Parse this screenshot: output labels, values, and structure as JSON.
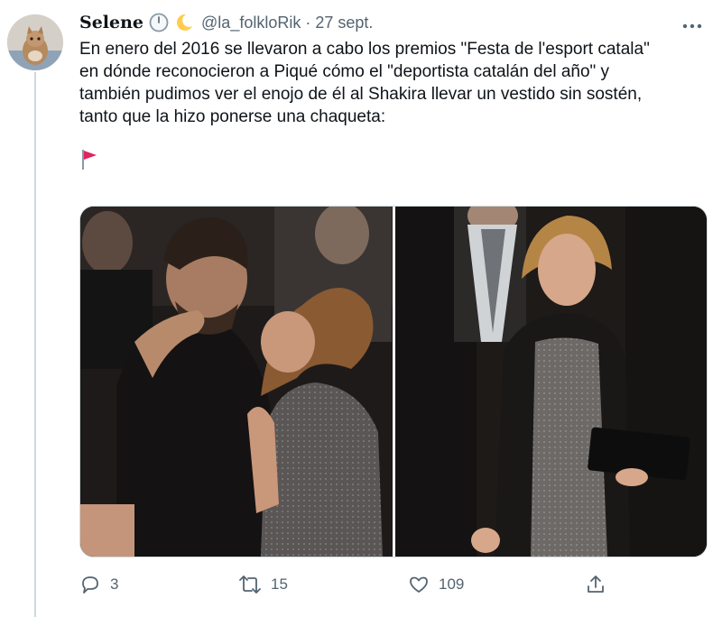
{
  "user": {
    "display_name": "Selene",
    "handle": "@la_folkloRik",
    "separator": "·",
    "date": "27 sept.",
    "name_emojis": [
      "clock-icon",
      "crescent-moon-icon"
    ]
  },
  "tweet": {
    "text": "En enero del 2016 se llevaron a cabo los premios \"Festa de l'esport catala\"\nen dónde reconocieron a Piqué cómo el \"deportista catalán del año\" y\ntambién pudimos ver el enojo de él al Shakira llevar un vestido sin sostén,\ntanto que la hizo ponerse una chaqueta:",
    "flag_icon": "red-flag-icon"
  },
  "media": {
    "images": [
      {
        "name": "photo-pique-whispering"
      },
      {
        "name": "photo-shakira-jacket"
      }
    ]
  },
  "actions": {
    "reply_count": "3",
    "retweet_count": "15",
    "like_count": "109"
  },
  "colors": {
    "text": "#0f1419",
    "secondary": "#536471",
    "border": "#cfd9de",
    "flag": "#e0245e"
  }
}
